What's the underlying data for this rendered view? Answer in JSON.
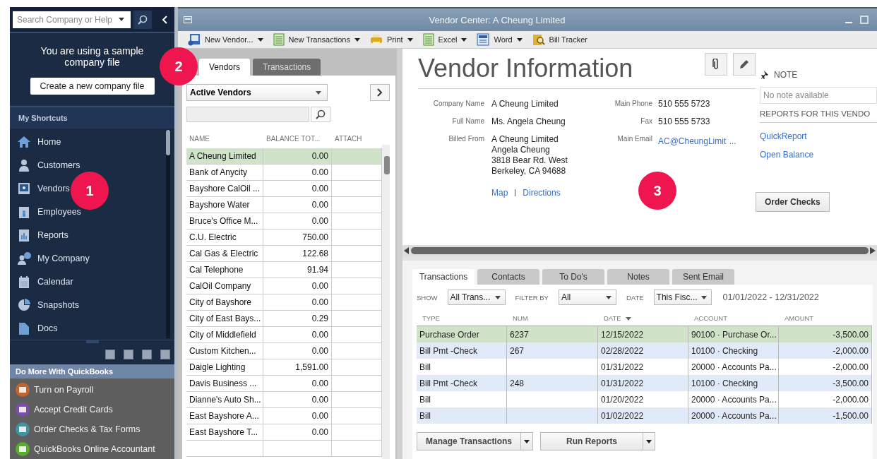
{
  "sidebar": {
    "search": {
      "placeholder": "Search Company or Help"
    },
    "notice": "You are using a sample company file",
    "create_button": "Create a new company file",
    "shortcuts_header": "My Shortcuts",
    "shortcuts": [
      "Home",
      "Customers",
      "Vendors",
      "Employees",
      "Reports",
      "My Company",
      "Calendar",
      "Snapshots",
      "Docs"
    ],
    "more_header": "Do More With QuickBooks",
    "more_items": [
      {
        "label": "Turn on Payroll",
        "color": "#c0662c"
      },
      {
        "label": "Accept Credit Cards",
        "color": "#7a4fa8"
      },
      {
        "label": "Order Checks & Tax Forms",
        "color": "#3f93a0"
      },
      {
        "label": "QuickBooks Online Accountant",
        "color": "#5aab2e"
      }
    ]
  },
  "callouts": [
    "1",
    "2",
    "3"
  ],
  "window": {
    "title": "Vendor Center: A Cheung Limited"
  },
  "toolbar": [
    {
      "label": "New Vendor...",
      "dropdown": true
    },
    {
      "label": "New Transactions",
      "dropdown": true
    },
    {
      "label": "Print",
      "dropdown": true
    },
    {
      "label": "Excel",
      "dropdown": true
    },
    {
      "label": "Word",
      "dropdown": true
    },
    {
      "label": "Bill Tracker",
      "dropdown": false
    }
  ],
  "vendor_tabs": [
    {
      "label": "Vendors",
      "selected": true
    },
    {
      "label": "Transactions",
      "selected": false
    }
  ],
  "vendor_filter": "Active Vendors",
  "vendor_table": {
    "columns": [
      "NAME",
      "BALANCE TOT...",
      "ATTACH"
    ],
    "rows": [
      {
        "name": "A Cheung Limited",
        "balance": "0.00",
        "selected": true
      },
      {
        "name": "Bank of Anycity",
        "balance": "0.00",
        "selected": false
      },
      {
        "name": "Bayshore CalOil ...",
        "balance": "0.00",
        "selected": false
      },
      {
        "name": "Bayshore Water",
        "balance": "0.00",
        "selected": false
      },
      {
        "name": "Bruce's Office M...",
        "balance": "0.00",
        "selected": false
      },
      {
        "name": "C.U. Electric",
        "balance": "750.00",
        "selected": false
      },
      {
        "name": "Cal Gas & Electric",
        "balance": "122.68",
        "selected": false
      },
      {
        "name": "Cal Telephone",
        "balance": "91.94",
        "selected": false
      },
      {
        "name": "CalOil Company",
        "balance": "0.00",
        "selected": false
      },
      {
        "name": "City of Bayshore",
        "balance": "0.00",
        "selected": false
      },
      {
        "name": "City of East Bays...",
        "balance": "0.29",
        "selected": false
      },
      {
        "name": "City of Middlefield",
        "balance": "0.00",
        "selected": false
      },
      {
        "name": "Custom Kitchen...",
        "balance": "0.00",
        "selected": false
      },
      {
        "name": "Daigle Lighting",
        "balance": "1,591.00",
        "selected": false
      },
      {
        "name": "Davis Business ...",
        "balance": "0.00",
        "selected": false
      },
      {
        "name": "Dianne's Auto Sh...",
        "balance": "0.00",
        "selected": false
      },
      {
        "name": "East Bayshore A...",
        "balance": "0.00",
        "selected": false
      },
      {
        "name": "East Bayshore T...",
        "balance": "0.00",
        "selected": false
      }
    ]
  },
  "vendor_info": {
    "title": "Vendor Information",
    "fields_left": [
      {
        "label": "Company Name",
        "lines": [
          "A Cheung Limited"
        ]
      },
      {
        "label": "Full Name",
        "lines": [
          "Ms. Angela  Cheung"
        ]
      },
      {
        "label": "Billed From",
        "lines": [
          "A Cheung Limited",
          "Angela Cheung",
          "3818 Bear Rd. West",
          "Berkeley, CA 94688"
        ]
      }
    ],
    "fields_right": [
      {
        "label": "Main Phone",
        "value": "510 555 5723",
        "kind": "text"
      },
      {
        "label": "Fax",
        "value": "510 555 5733",
        "kind": "text"
      },
      {
        "label": "Main Email",
        "value": "AC@CheungLimit",
        "kind": "link"
      }
    ],
    "email_more": "...",
    "map_links": [
      "Map",
      "Directions"
    ]
  },
  "note": {
    "header": "NOTE",
    "text": "No note available"
  },
  "reports": {
    "header": "REPORTS FOR THIS VENDO",
    "links": [
      "QuickReport",
      "Open Balance"
    ]
  },
  "order_checks": "Order Checks",
  "detail_tabs": [
    {
      "label": "Transactions",
      "selected": true
    },
    {
      "label": "Contacts",
      "selected": false
    },
    {
      "label": "To Do's",
      "selected": false
    },
    {
      "label": "Notes",
      "selected": false
    },
    {
      "label": "Sent Email",
      "selected": false
    }
  ],
  "filters": [
    {
      "label": "SHOW",
      "value": "All Trans..."
    },
    {
      "label": "FILTER BY",
      "value": "All"
    },
    {
      "label": "DATE",
      "value": "This Fisc..."
    }
  ],
  "date_range": "01/01/2022 - 12/31/2022",
  "transactions": {
    "columns": [
      {
        "label": "TYPE",
        "sorted": false
      },
      {
        "label": "NUM",
        "sorted": false
      },
      {
        "label": "DATE",
        "sorted": true
      },
      {
        "label": "ACCOUNT",
        "sorted": false
      },
      {
        "label": "AMOUNT",
        "sorted": false
      }
    ],
    "rows": [
      {
        "cells": [
          "Purchase Order",
          "6237",
          "12/15/2022",
          "90100 · Purchase Or...",
          "-3,500.00"
        ],
        "selected": true
      },
      {
        "cells": [
          "Bill Pmt -Check",
          "267",
          "02/28/2022",
          "10100 · Checking",
          "-2,000.00"
        ],
        "selected": false
      },
      {
        "cells": [
          "Bill",
          "",
          "01/31/2022",
          "20000 · Accounts Pa...",
          "-2,000.00"
        ],
        "selected": false
      },
      {
        "cells": [
          "Bill Pmt -Check",
          "248",
          "01/31/2022",
          "10100 · Checking",
          "-3,500.00"
        ],
        "selected": false
      },
      {
        "cells": [
          "Bill",
          "",
          "01/20/2022",
          "20000 · Accounts Pa...",
          "-2,000.00"
        ],
        "selected": false
      },
      {
        "cells": [
          "Bill",
          "",
          "01/02/2022",
          "20000 · Accounts Pa...",
          "-1,500.00"
        ],
        "selected": false
      }
    ]
  },
  "buttons": [
    "Manage Transactions",
    "Run Reports"
  ]
}
